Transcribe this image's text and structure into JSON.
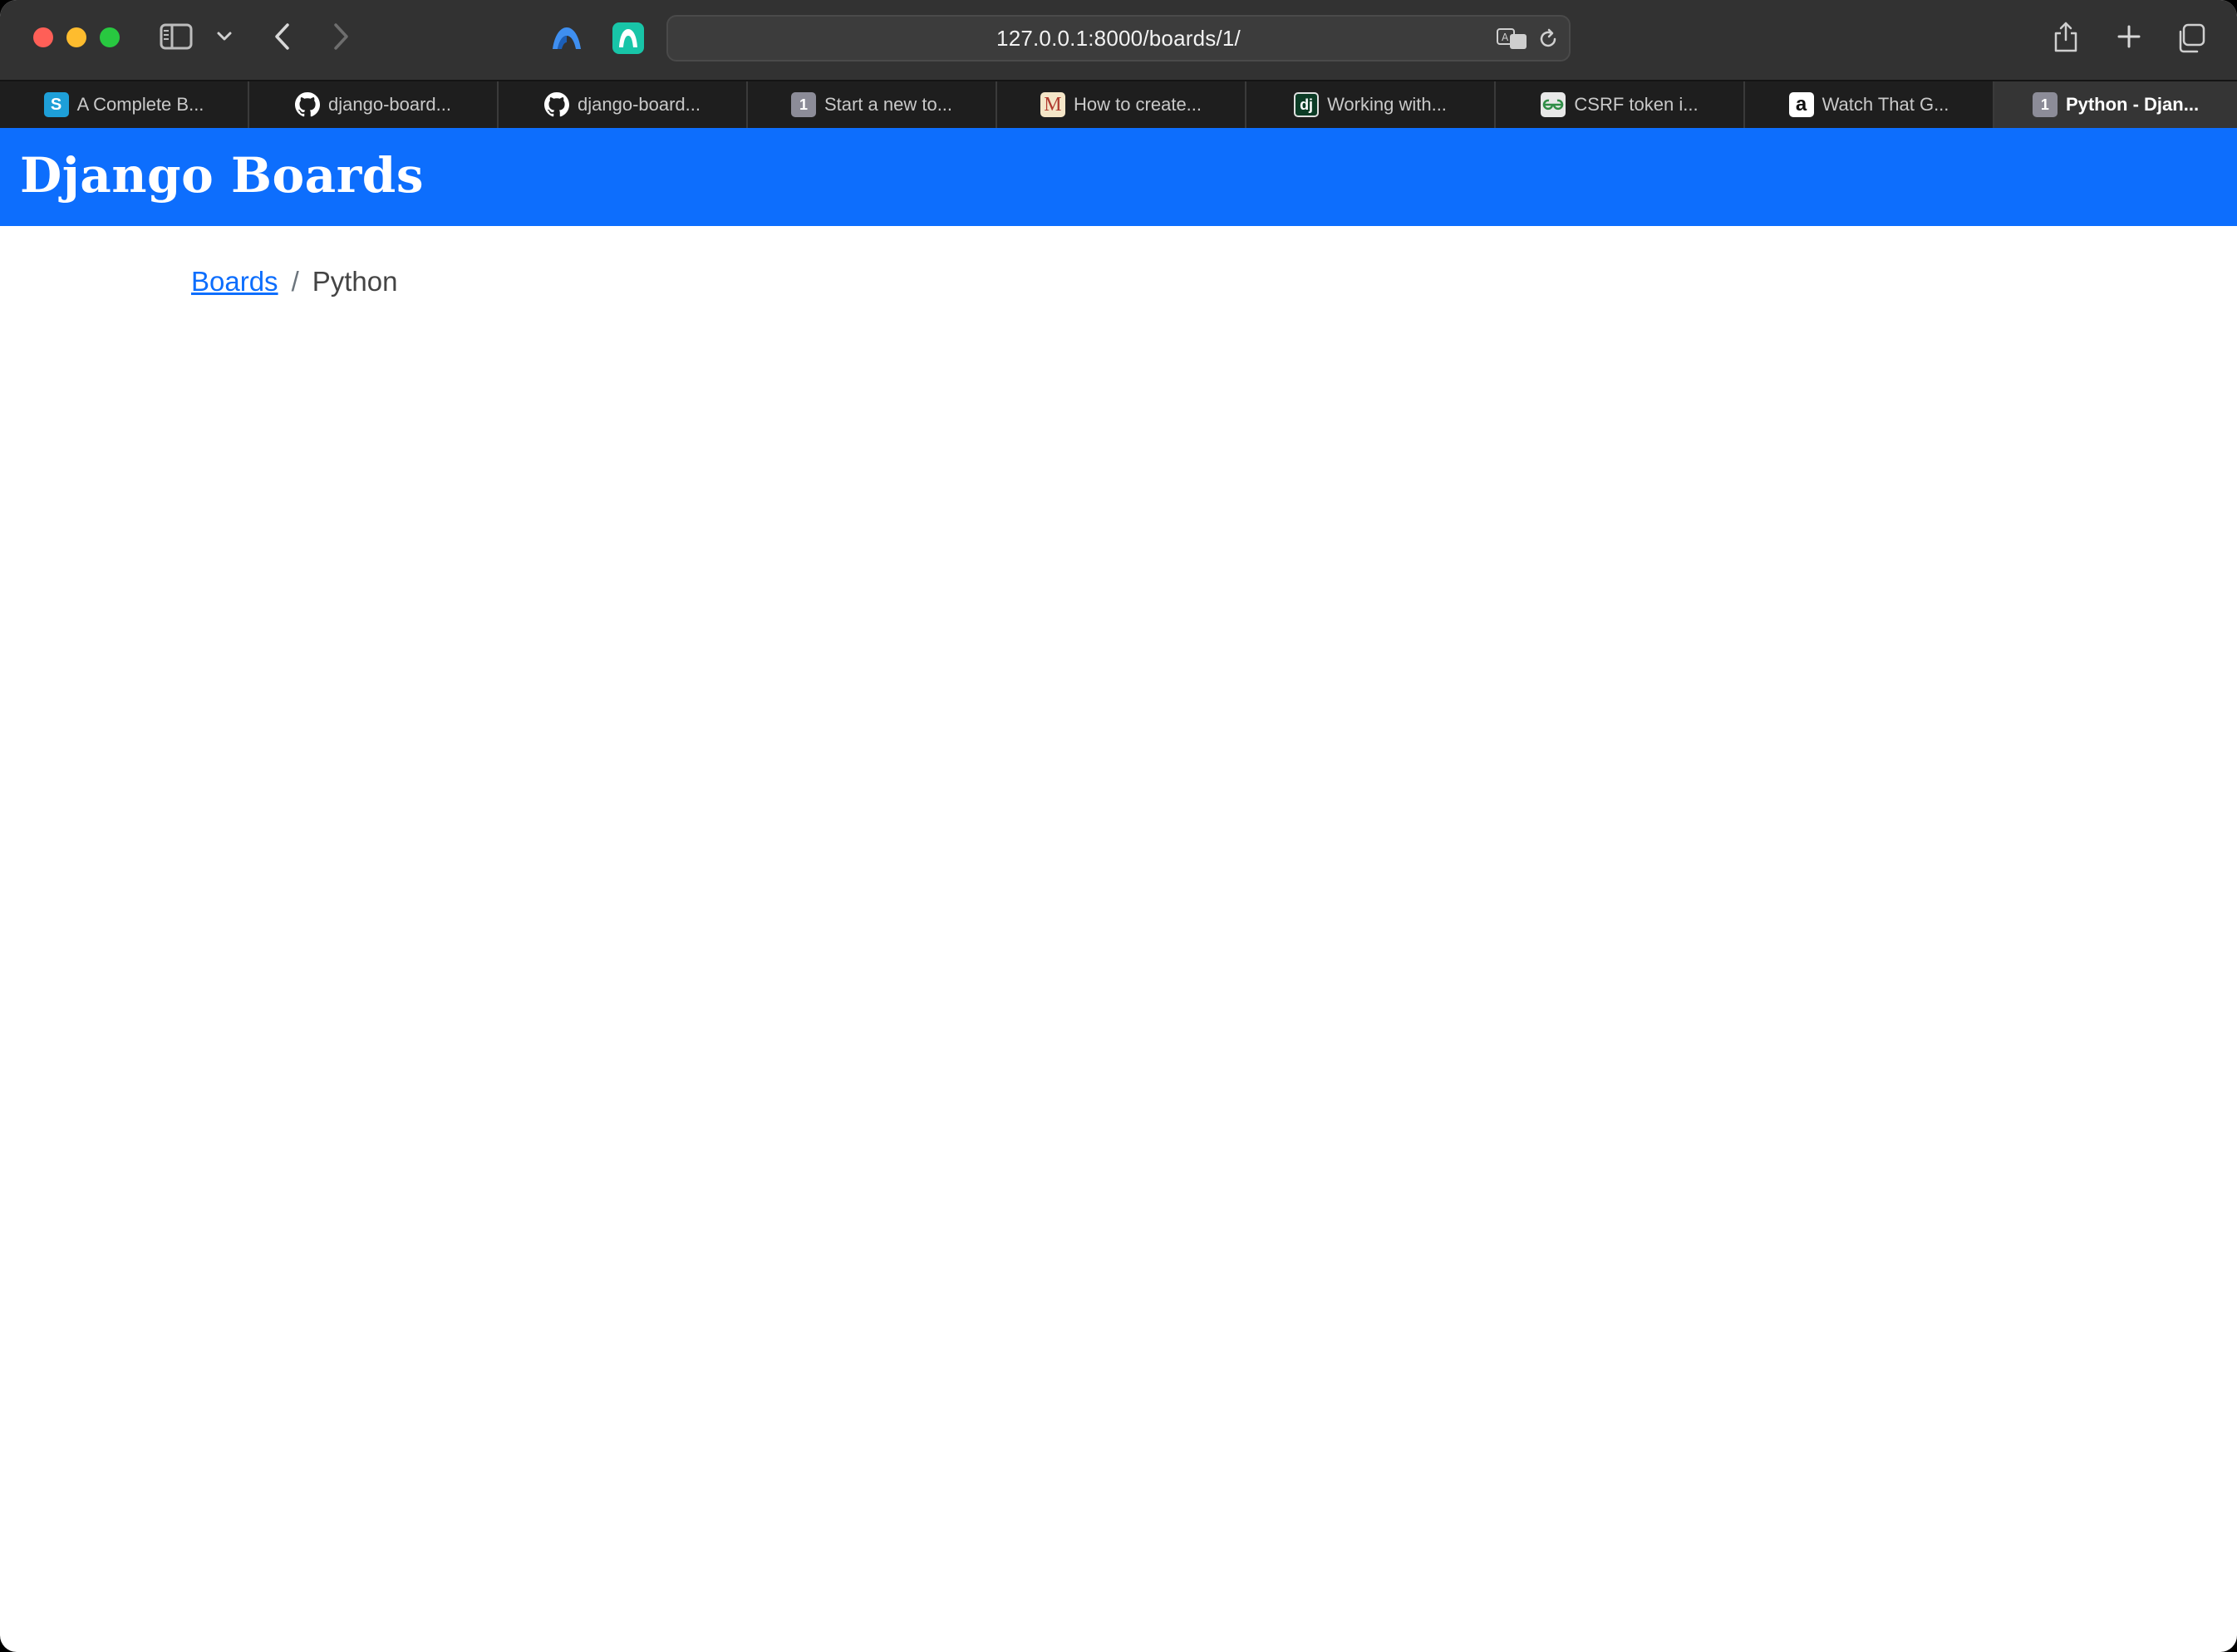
{
  "browser": {
    "url": "127.0.0.1:8000/boards/1/",
    "tabs": [
      {
        "label": "A Complete B...",
        "icon": "s-favicon-icon",
        "active": false
      },
      {
        "label": "django-board...",
        "icon": "github-icon",
        "active": false
      },
      {
        "label": "django-board...",
        "icon": "github-icon",
        "active": false
      },
      {
        "label": "Start a new to...",
        "icon": "number-one-favicon-icon",
        "favicon_text": "1",
        "active": false
      },
      {
        "label": "How to create...",
        "icon": "medium-favicon-icon",
        "active": false
      },
      {
        "label": "Working with...",
        "icon": "django-favicon-icon",
        "active": false
      },
      {
        "label": "CSRF token i...",
        "icon": "geeksforgeeks-icon",
        "active": false
      },
      {
        "label": "Watch That G...",
        "icon": "amazon-icon",
        "active": false
      },
      {
        "label": "Python - Djan...",
        "icon": "number-one-favicon-icon",
        "favicon_text": "1",
        "active": true
      }
    ],
    "favicon_letters": {
      "s": "S",
      "m": "M",
      "dj": "dj",
      "a": "a",
      "one": "1"
    }
  },
  "page": {
    "brand": "Django Boards",
    "breadcrumb": {
      "root_label": "Boards",
      "separator": "/",
      "current": "Python"
    }
  },
  "colors": {
    "navbar": "#0d6efd",
    "link": "#0d6efd",
    "chrome": "#323232",
    "tabbar": "#1e1e1e"
  }
}
